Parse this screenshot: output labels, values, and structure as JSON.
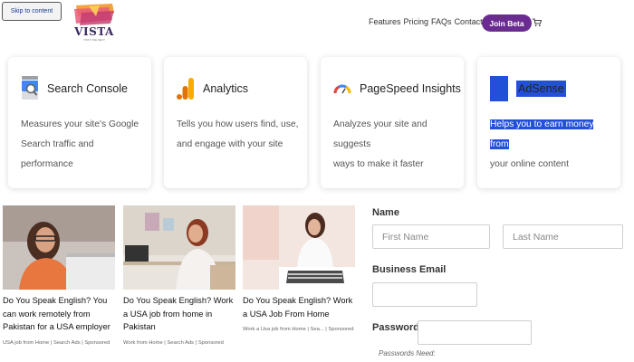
{
  "header": {
    "skip_link": "Skip to content",
    "logo_text": "VISTA",
    "logo_tagline": "VISTA THE NEXT",
    "nav": [
      "Features",
      "Pricing",
      "FAQs",
      "Contact"
    ],
    "join_button": "Join Beta",
    "cart_icon": "cart-icon"
  },
  "cards": [
    {
      "title": "Search Console",
      "desc_lines": [
        "Measures your site's Google",
        "Search traffic and performance"
      ],
      "icon": "search-console-icon",
      "highlighted": false
    },
    {
      "title": "Analytics",
      "desc_lines": [
        "Tells you how users find, use,",
        "and engage with your site"
      ],
      "icon": "analytics-icon",
      "highlighted": false
    },
    {
      "title": "PageSpeed Insights",
      "desc_lines": [
        "Analyzes your site and suggests",
        "ways to make it faster"
      ],
      "icon": "pagespeed-icon",
      "highlighted": false
    },
    {
      "title": "AdSense",
      "desc_lines": [
        "Helps you to earn money from",
        "your online content"
      ],
      "icon": "adsense-icon",
      "highlighted": true
    }
  ],
  "ads": [
    {
      "title": "Do You Speak English? You can work remotely from Pakistan for a USA employer",
      "source": "USA job from Home | Search Ads",
      "sponsored": "Sponsored"
    },
    {
      "title": "Do You Speak English? Work a USA job from home in Pakistan",
      "source": "Work from Home | Search Ads",
      "sponsored": "Sponsored"
    },
    {
      "title": "Do You Speak English? Work a USA Job From Home",
      "source": "Work a Usa job from Home | Sea...",
      "sponsored": "Sponsored"
    }
  ],
  "form": {
    "name_label": "Name",
    "first_placeholder": "First Name",
    "last_placeholder": "Last Name",
    "email_label": "Business Email",
    "password_label": "Password",
    "password_note": "Passwords Need:"
  },
  "colors": {
    "brand_purple": "#6b2c91",
    "highlight_blue": "#2350d8"
  }
}
